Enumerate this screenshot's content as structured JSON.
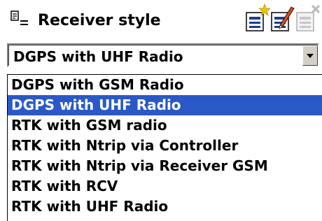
{
  "header": {
    "label": "Receiver style",
    "icon": "filter-list-icon"
  },
  "toolbar": {
    "new_icon": "new-document-icon",
    "edit_icon": "edit-document-icon",
    "delete_icon": "delete-document-icon"
  },
  "combo": {
    "selected_value": "DGPS with UHF Radio"
  },
  "dropdown": {
    "options": [
      "DGPS with GSM Radio",
      "DGPS with UHF Radio",
      "RTK with GSM radio",
      "RTK with Ntrip via Controller",
      "RTK with Ntrip via Receiver GSM",
      "RTK with RCV",
      "RTK with UHF Radio"
    ],
    "selected_index": 1
  },
  "colors": {
    "selection": "#2a59c7",
    "selection_text": "#ffffff"
  }
}
